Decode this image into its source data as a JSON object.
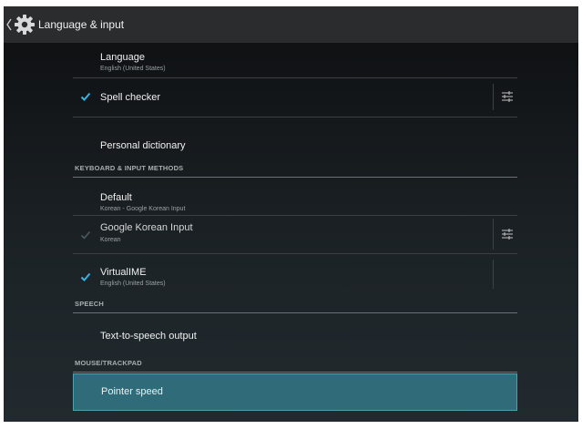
{
  "actionbar": {
    "title": "Language & input"
  },
  "rows": {
    "language": {
      "title": "Language",
      "summary": "English (United States)"
    },
    "spell_checker": {
      "title": "Spell checker",
      "checked": true
    },
    "personal_dictionary": {
      "title": "Personal dictionary"
    },
    "default": {
      "title": "Default",
      "summary": "Korean - Google Korean Input"
    },
    "google_korean": {
      "title": "Google Korean Input",
      "summary": "Korean",
      "checked": true,
      "enabled": false
    },
    "virtual_ime": {
      "title": "VirtualIME",
      "summary": "English (United States)",
      "checked": true
    },
    "tts": {
      "title": "Text-to-speech output"
    },
    "pointer_speed": {
      "title": "Pointer speed",
      "selected": true
    }
  },
  "sections": {
    "keyboard": "KEYBOARD & INPUT METHODS",
    "speech": "SPEECH",
    "mouse": "MOUSE/TRACKPAD"
  },
  "icons": {
    "back": "chevron-left-icon",
    "app": "gear-icon",
    "check": "checkmark-icon",
    "settings": "sliders-icon"
  },
  "colors": {
    "accent": "#33b5e5",
    "selected_bg": "#2f6b78",
    "text_primary": "#f0f0f0",
    "text_secondary": "#9aa0a3"
  }
}
